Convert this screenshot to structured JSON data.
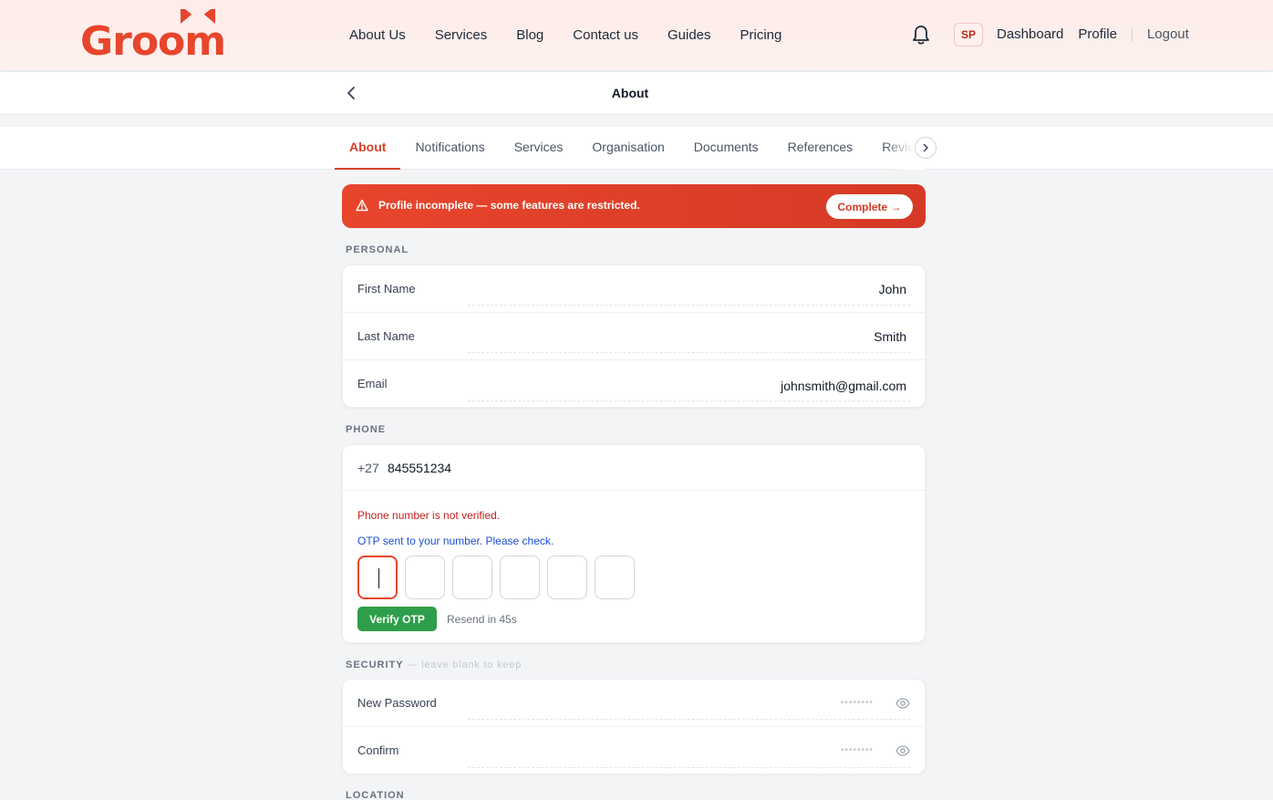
{
  "brand": {
    "name": "Groom",
    "tm": "™",
    "color": "#e8452c"
  },
  "nav": {
    "links": [
      "About Us",
      "Services",
      "Blog",
      "Contact us",
      "Guides",
      "Pricing"
    ]
  },
  "user": {
    "initials": "SP",
    "dashboard": "Dashboard",
    "profile": "Profile",
    "logout": "Logout"
  },
  "page": {
    "title": "About"
  },
  "tabs": [
    "About",
    "Notifications",
    "Services",
    "Organisation",
    "Documents",
    "References",
    "Reviews"
  ],
  "banner": {
    "message": "Profile incomplete — some features are restricted.",
    "cta": "Complete →"
  },
  "personal": {
    "label": "PERSONAL",
    "fields": [
      {
        "label": "First Name",
        "value": "John"
      },
      {
        "label": "Last Name",
        "value": "Smith"
      },
      {
        "label": "Email",
        "value": "johnsmith@gmail.com"
      }
    ]
  },
  "phone": {
    "label": "PHONE",
    "country_code": "+27",
    "number": "845551234",
    "error": "Phone number is not verified.",
    "otp_message": "OTP sent to your number. Please check.",
    "verify_label": "Verify OTP",
    "resend": "Resend in 45s"
  },
  "security": {
    "label": "SECURITY",
    "hint": "— leave blank to keep",
    "fields": [
      {
        "label": "New Password",
        "mask": "••••••••"
      },
      {
        "label": "Confirm",
        "mask": "••••••••"
      }
    ]
  },
  "location": {
    "label": "LOCATION"
  }
}
